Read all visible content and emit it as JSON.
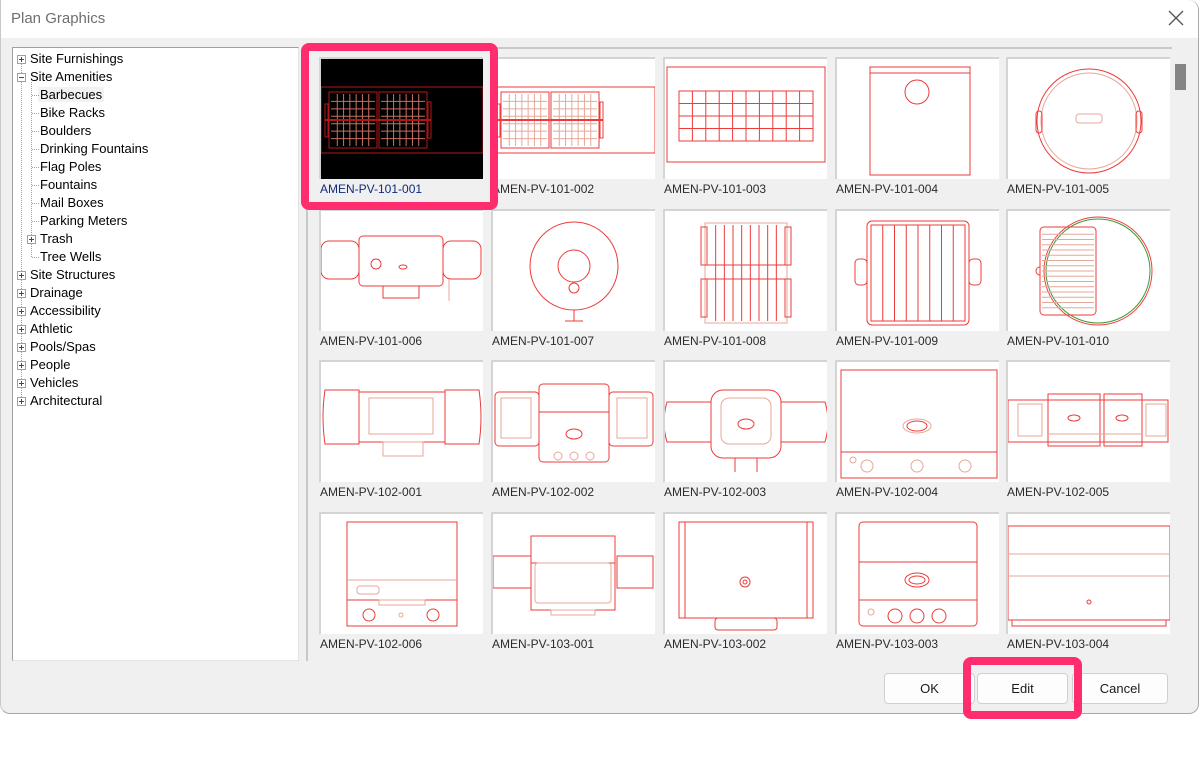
{
  "window": {
    "title": "Plan Graphics",
    "close_icon": "close-icon"
  },
  "tree": {
    "items": [
      {
        "label": "Site Furnishings",
        "level": 0,
        "expander": "plus"
      },
      {
        "label": "Site Amenities",
        "level": 0,
        "expander": "minus"
      },
      {
        "label": "Barbecues",
        "level": 1,
        "expander": "none",
        "selected": true
      },
      {
        "label": "Bike Racks",
        "level": 1,
        "expander": "none"
      },
      {
        "label": "Boulders",
        "level": 1,
        "expander": "none"
      },
      {
        "label": "Drinking Fountains",
        "level": 1,
        "expander": "none"
      },
      {
        "label": "Flag Poles",
        "level": 1,
        "expander": "none"
      },
      {
        "label": "Fountains",
        "level": 1,
        "expander": "none"
      },
      {
        "label": "Mail Boxes",
        "level": 1,
        "expander": "none"
      },
      {
        "label": "Parking Meters",
        "level": 1,
        "expander": "none"
      },
      {
        "label": "Trash",
        "level": 1,
        "expander": "plus"
      },
      {
        "label": "Tree Wells",
        "level": 1,
        "expander": "none"
      },
      {
        "label": "Site Structures",
        "level": 0,
        "expander": "plus"
      },
      {
        "label": "Drainage",
        "level": 0,
        "expander": "plus"
      },
      {
        "label": "Accessibility",
        "level": 0,
        "expander": "plus"
      },
      {
        "label": "Athletic",
        "level": 0,
        "expander": "plus"
      },
      {
        "label": "Pools/Spas",
        "level": 0,
        "expander": "plus"
      },
      {
        "label": "People",
        "level": 0,
        "expander": "plus"
      },
      {
        "label": "Vehicles",
        "level": 0,
        "expander": "plus"
      },
      {
        "label": "Architectural",
        "level": 0,
        "expander": "plus"
      }
    ]
  },
  "gallery": {
    "selected": "AMEN-PV-101-001",
    "items": [
      {
        "name": "AMEN-PV-101-001",
        "glyph": "grill-grate-double"
      },
      {
        "name": "AMEN-PV-101-002",
        "glyph": "grill-grate-double"
      },
      {
        "name": "AMEN-PV-101-003",
        "glyph": "grill-grate-grid"
      },
      {
        "name": "AMEN-PV-101-004",
        "glyph": "box-with-circle"
      },
      {
        "name": "AMEN-PV-101-005",
        "glyph": "round-kettle"
      },
      {
        "name": "AMEN-PV-101-006",
        "glyph": "barrel-grill"
      },
      {
        "name": "AMEN-PV-101-007",
        "glyph": "round-grill-stand"
      },
      {
        "name": "AMEN-PV-101-008",
        "glyph": "double-grate-handles"
      },
      {
        "name": "AMEN-PV-101-009",
        "glyph": "square-grill-handles"
      },
      {
        "name": "AMEN-PV-101-010",
        "glyph": "round-with-grate"
      },
      {
        "name": "AMEN-PV-102-001",
        "glyph": "grill-side-tables"
      },
      {
        "name": "AMEN-PV-102-002",
        "glyph": "gas-grill-side-burners"
      },
      {
        "name": "AMEN-PV-102-003",
        "glyph": "portable-gas-grill"
      },
      {
        "name": "AMEN-PV-102-004",
        "glyph": "gas-grill-knobs"
      },
      {
        "name": "AMEN-PV-102-005",
        "glyph": "double-gas-grill"
      },
      {
        "name": "AMEN-PV-102-006",
        "glyph": "gas-grill-front"
      },
      {
        "name": "AMEN-PV-103-001",
        "glyph": "grill-side-shelves"
      },
      {
        "name": "AMEN-PV-103-002",
        "glyph": "grill-lid-handle"
      },
      {
        "name": "AMEN-PV-103-003",
        "glyph": "gas-grill-three-knobs"
      },
      {
        "name": "AMEN-PV-103-004",
        "glyph": "grill-cart"
      }
    ]
  },
  "buttons": {
    "ok": "OK",
    "edit": "Edit",
    "cancel": "Cancel"
  },
  "colors": {
    "highlight": "#ff2d6e",
    "drawing_line": "#ee3b3b",
    "drawing_line_light": "#e8b0a0",
    "drawing_green": "#3a9a3a",
    "selected_caption": "#102a7a"
  }
}
